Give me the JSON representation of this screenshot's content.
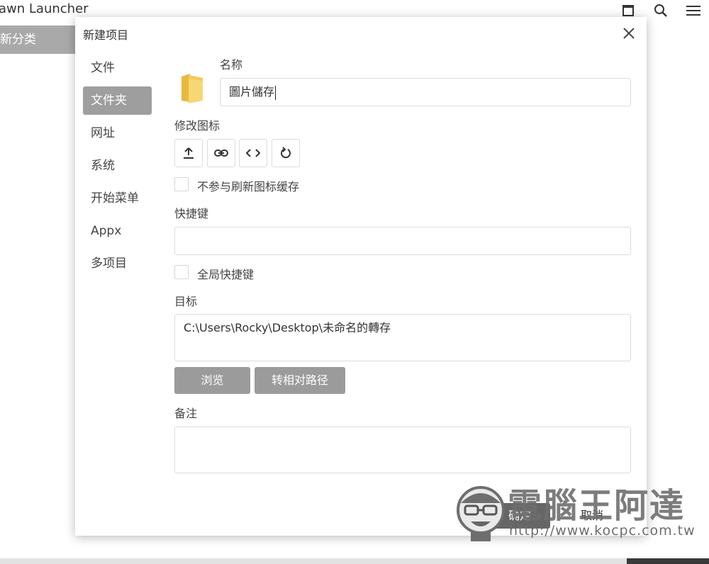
{
  "app": {
    "title": "awn Launcher",
    "category_label": "新分类"
  },
  "dialog": {
    "title": "新建项目",
    "nav": [
      {
        "label": "文件",
        "active": false
      },
      {
        "label": "文件夹",
        "active": true
      },
      {
        "label": "网址",
        "active": false
      },
      {
        "label": "系统",
        "active": false
      },
      {
        "label": "开始菜单",
        "active": false
      },
      {
        "label": "Appx",
        "active": false
      },
      {
        "label": "多项目",
        "active": false
      }
    ],
    "name_label": "名称",
    "name_value": "圖片儲存",
    "change_icon_label": "修改图标",
    "icon_buttons": [
      "upload-icon",
      "link-icon",
      "code-icon",
      "refresh-icon"
    ],
    "no_refresh_cache_label": "不参与刷新图标缓存",
    "hotkey_label": "快捷键",
    "hotkey_value": "",
    "global_hotkey_label": "全局快捷键",
    "target_label": "目标",
    "target_value": "C:\\Users\\Rocky\\Desktop\\未命名的轉存",
    "browse_label": "浏览",
    "relative_path_label": "转相对路径",
    "notes_label": "备注",
    "notes_value": "",
    "ok_label": "确定",
    "cancel_label": "取消"
  },
  "watermark": {
    "brand": "電腦王阿達",
    "url": "http://www.kocpc.com.tw"
  },
  "colors": {
    "active_nav": "#9e9e9e",
    "gray_button": "#9b9b9b",
    "folder": "#f7d774",
    "border": "#dcdcdc"
  }
}
